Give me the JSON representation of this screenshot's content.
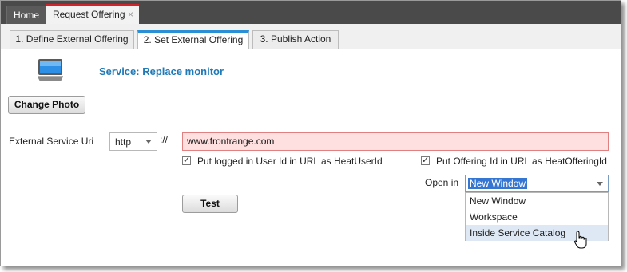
{
  "top_tabs": {
    "home": "Home",
    "request": "Request Offering",
    "close_glyph": "×"
  },
  "steps": [
    {
      "label": "1. Define External Offering"
    },
    {
      "label": "2. Set External Offering"
    },
    {
      "label": "3. Publish Action"
    }
  ],
  "service": {
    "title": "Service: Replace monitor",
    "icon": "monitor-icon",
    "change_photo": "Change Photo"
  },
  "form": {
    "uri_label": "External Service Uri",
    "protocol": "http",
    "separator": "://",
    "url": "www.frontrange.com",
    "user_id_label": "Put logged in User Id in URL as HeatUserId",
    "offering_id_label": "Put Offering Id in URL as HeatOfferingId",
    "open_in_label": "Open in",
    "open_in_value": "New Window",
    "open_in_options": [
      "New Window",
      "Workspace",
      "Inside Service Catalog"
    ],
    "hovered_option": "Inside Service Catalog",
    "test_button": "Test"
  },
  "colors": {
    "accent_tab": "#d2232a",
    "active_step": "#2a8fd4",
    "title": "#1f7ab8",
    "error_field": "#ffe0e0",
    "selection": "#3476d1"
  }
}
